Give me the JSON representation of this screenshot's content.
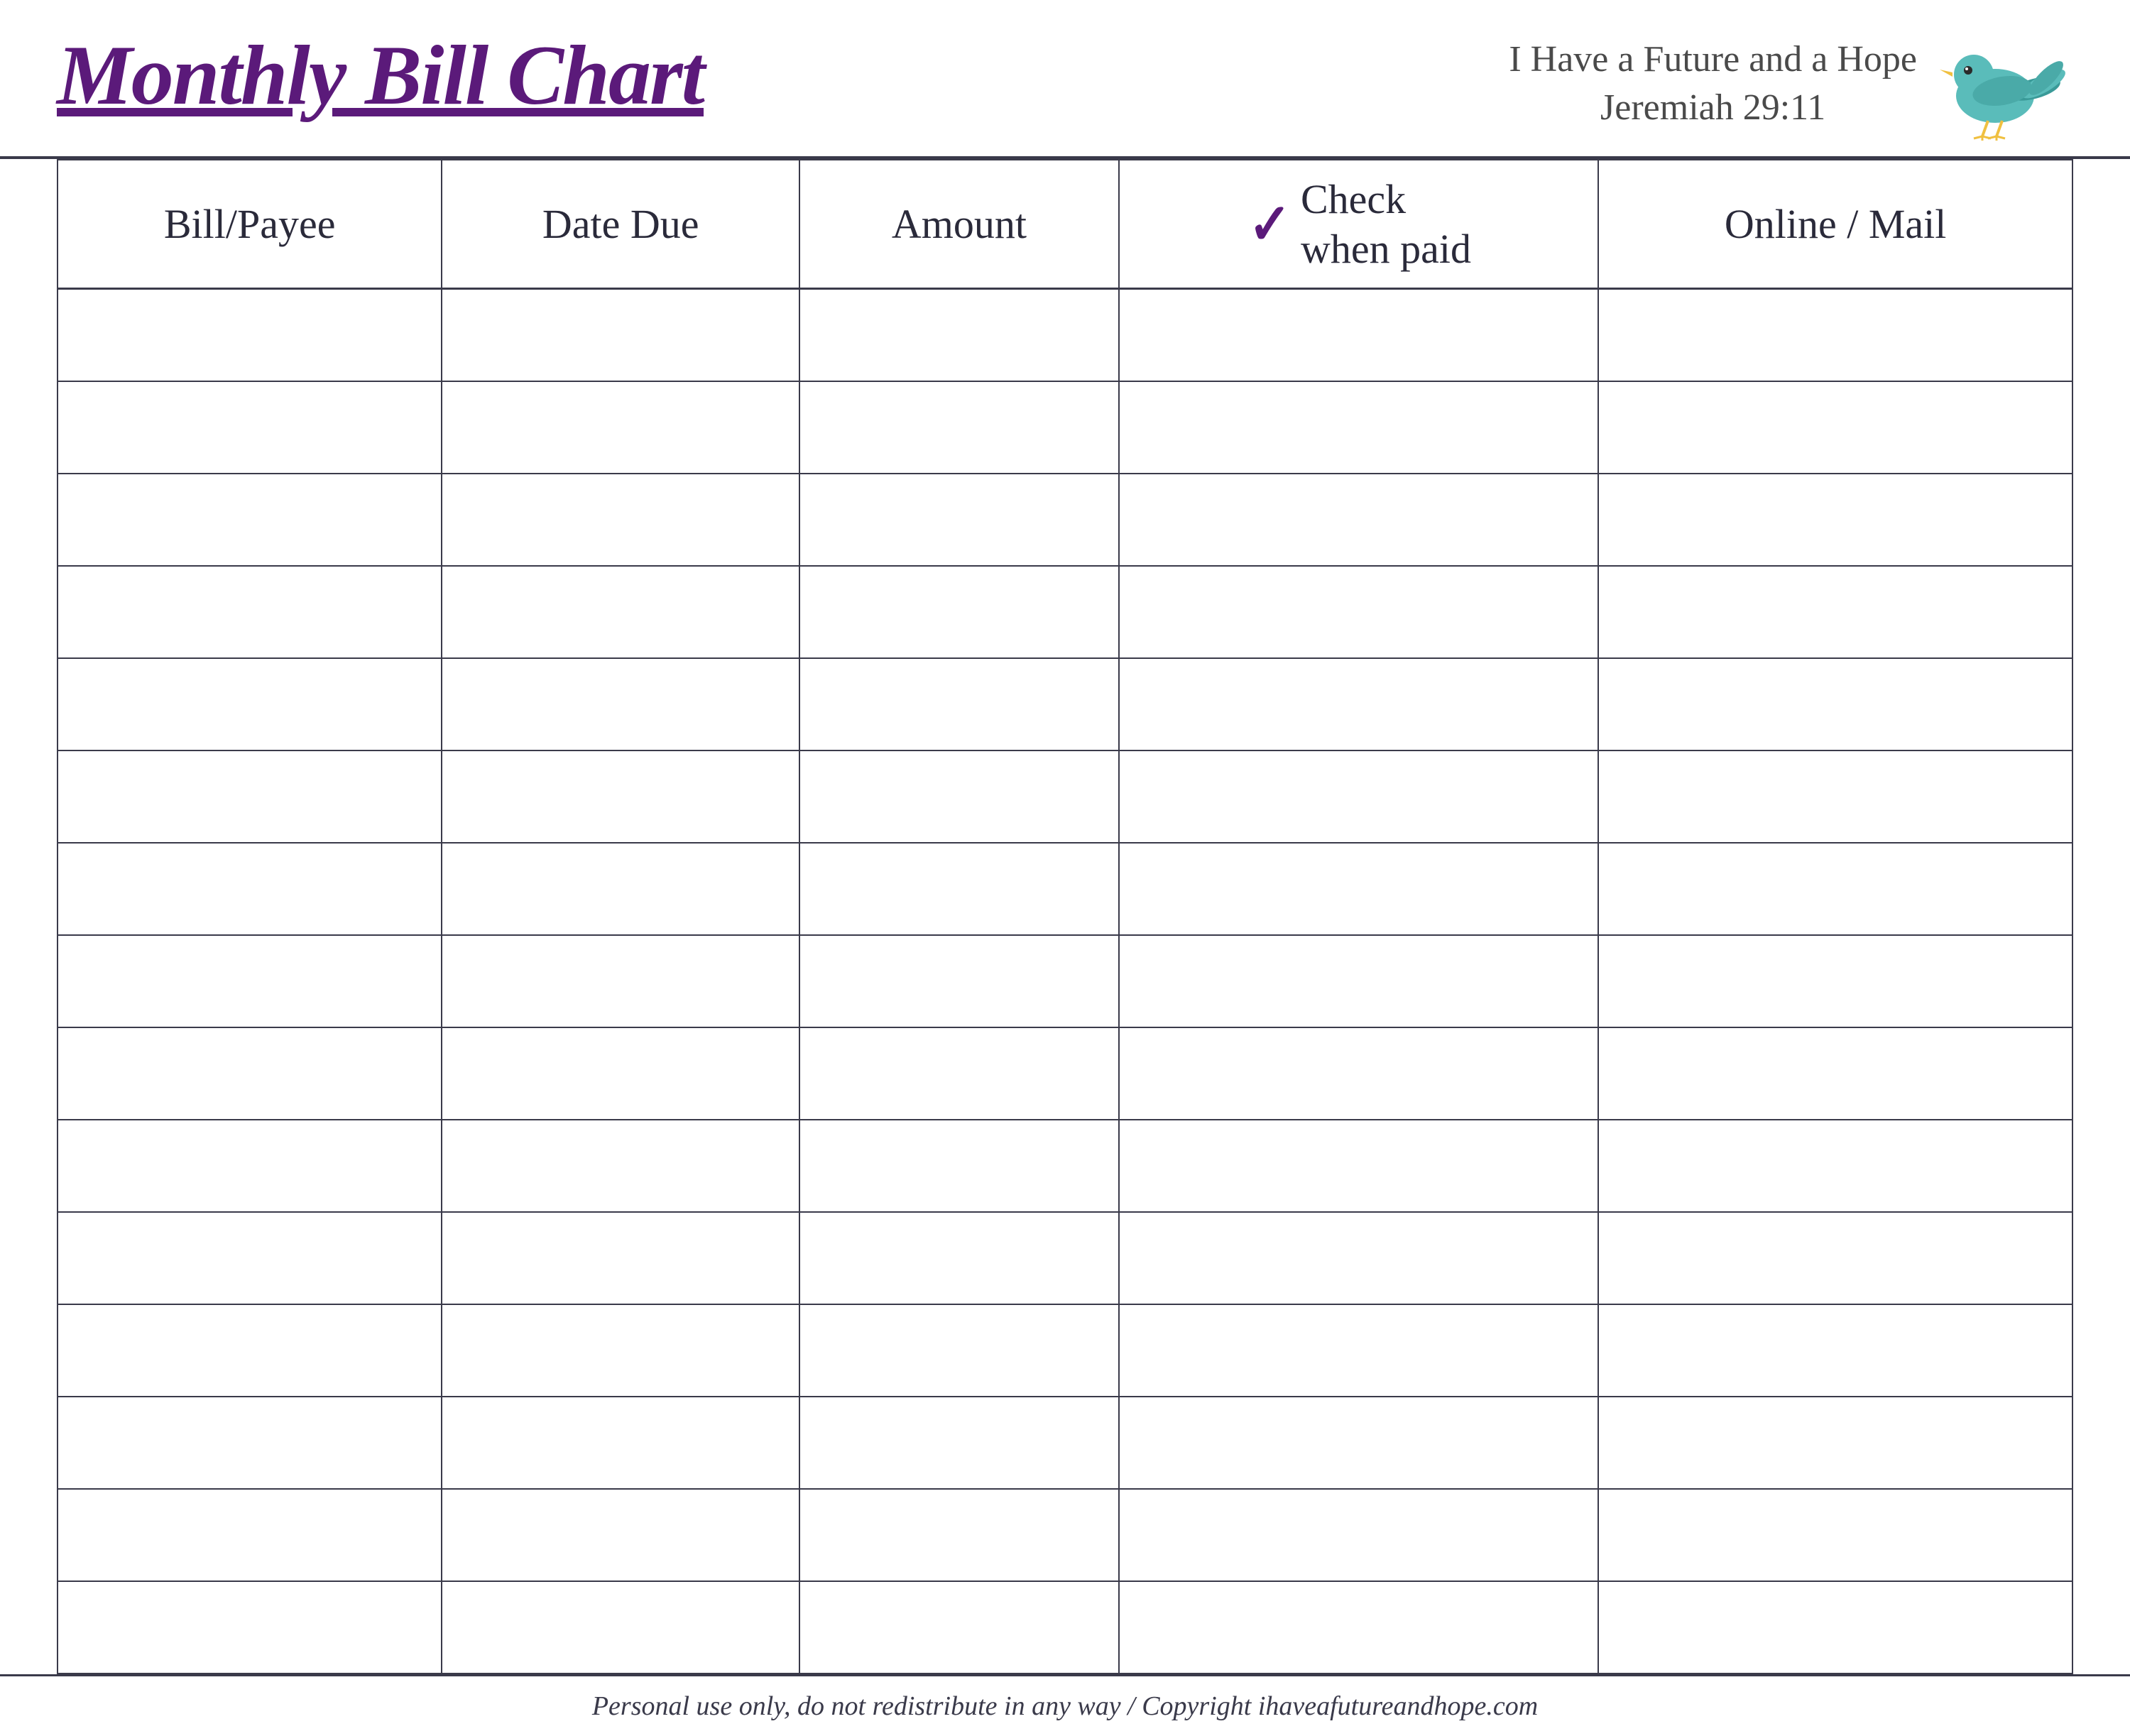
{
  "page": {
    "title": "Monthly Bill Chart",
    "subtitle_line1": "I Have a Future and a Hope",
    "subtitle_line2": "Jeremiah 29:11",
    "footer": "Personal use only, do not redistribute in any way / Copyright ihaveafutureandhope.com"
  },
  "table": {
    "columns": [
      {
        "id": "bill-payee",
        "label": "Bill/Payee"
      },
      {
        "id": "date-due",
        "label": "Date Due"
      },
      {
        "id": "amount",
        "label": "Amount"
      },
      {
        "id": "check-when-paid",
        "label_line1": "Check",
        "label_line2": "when paid",
        "checkmark": "✓"
      },
      {
        "id": "online-mail",
        "label": "Online / Mail"
      }
    ],
    "row_count": 15
  }
}
